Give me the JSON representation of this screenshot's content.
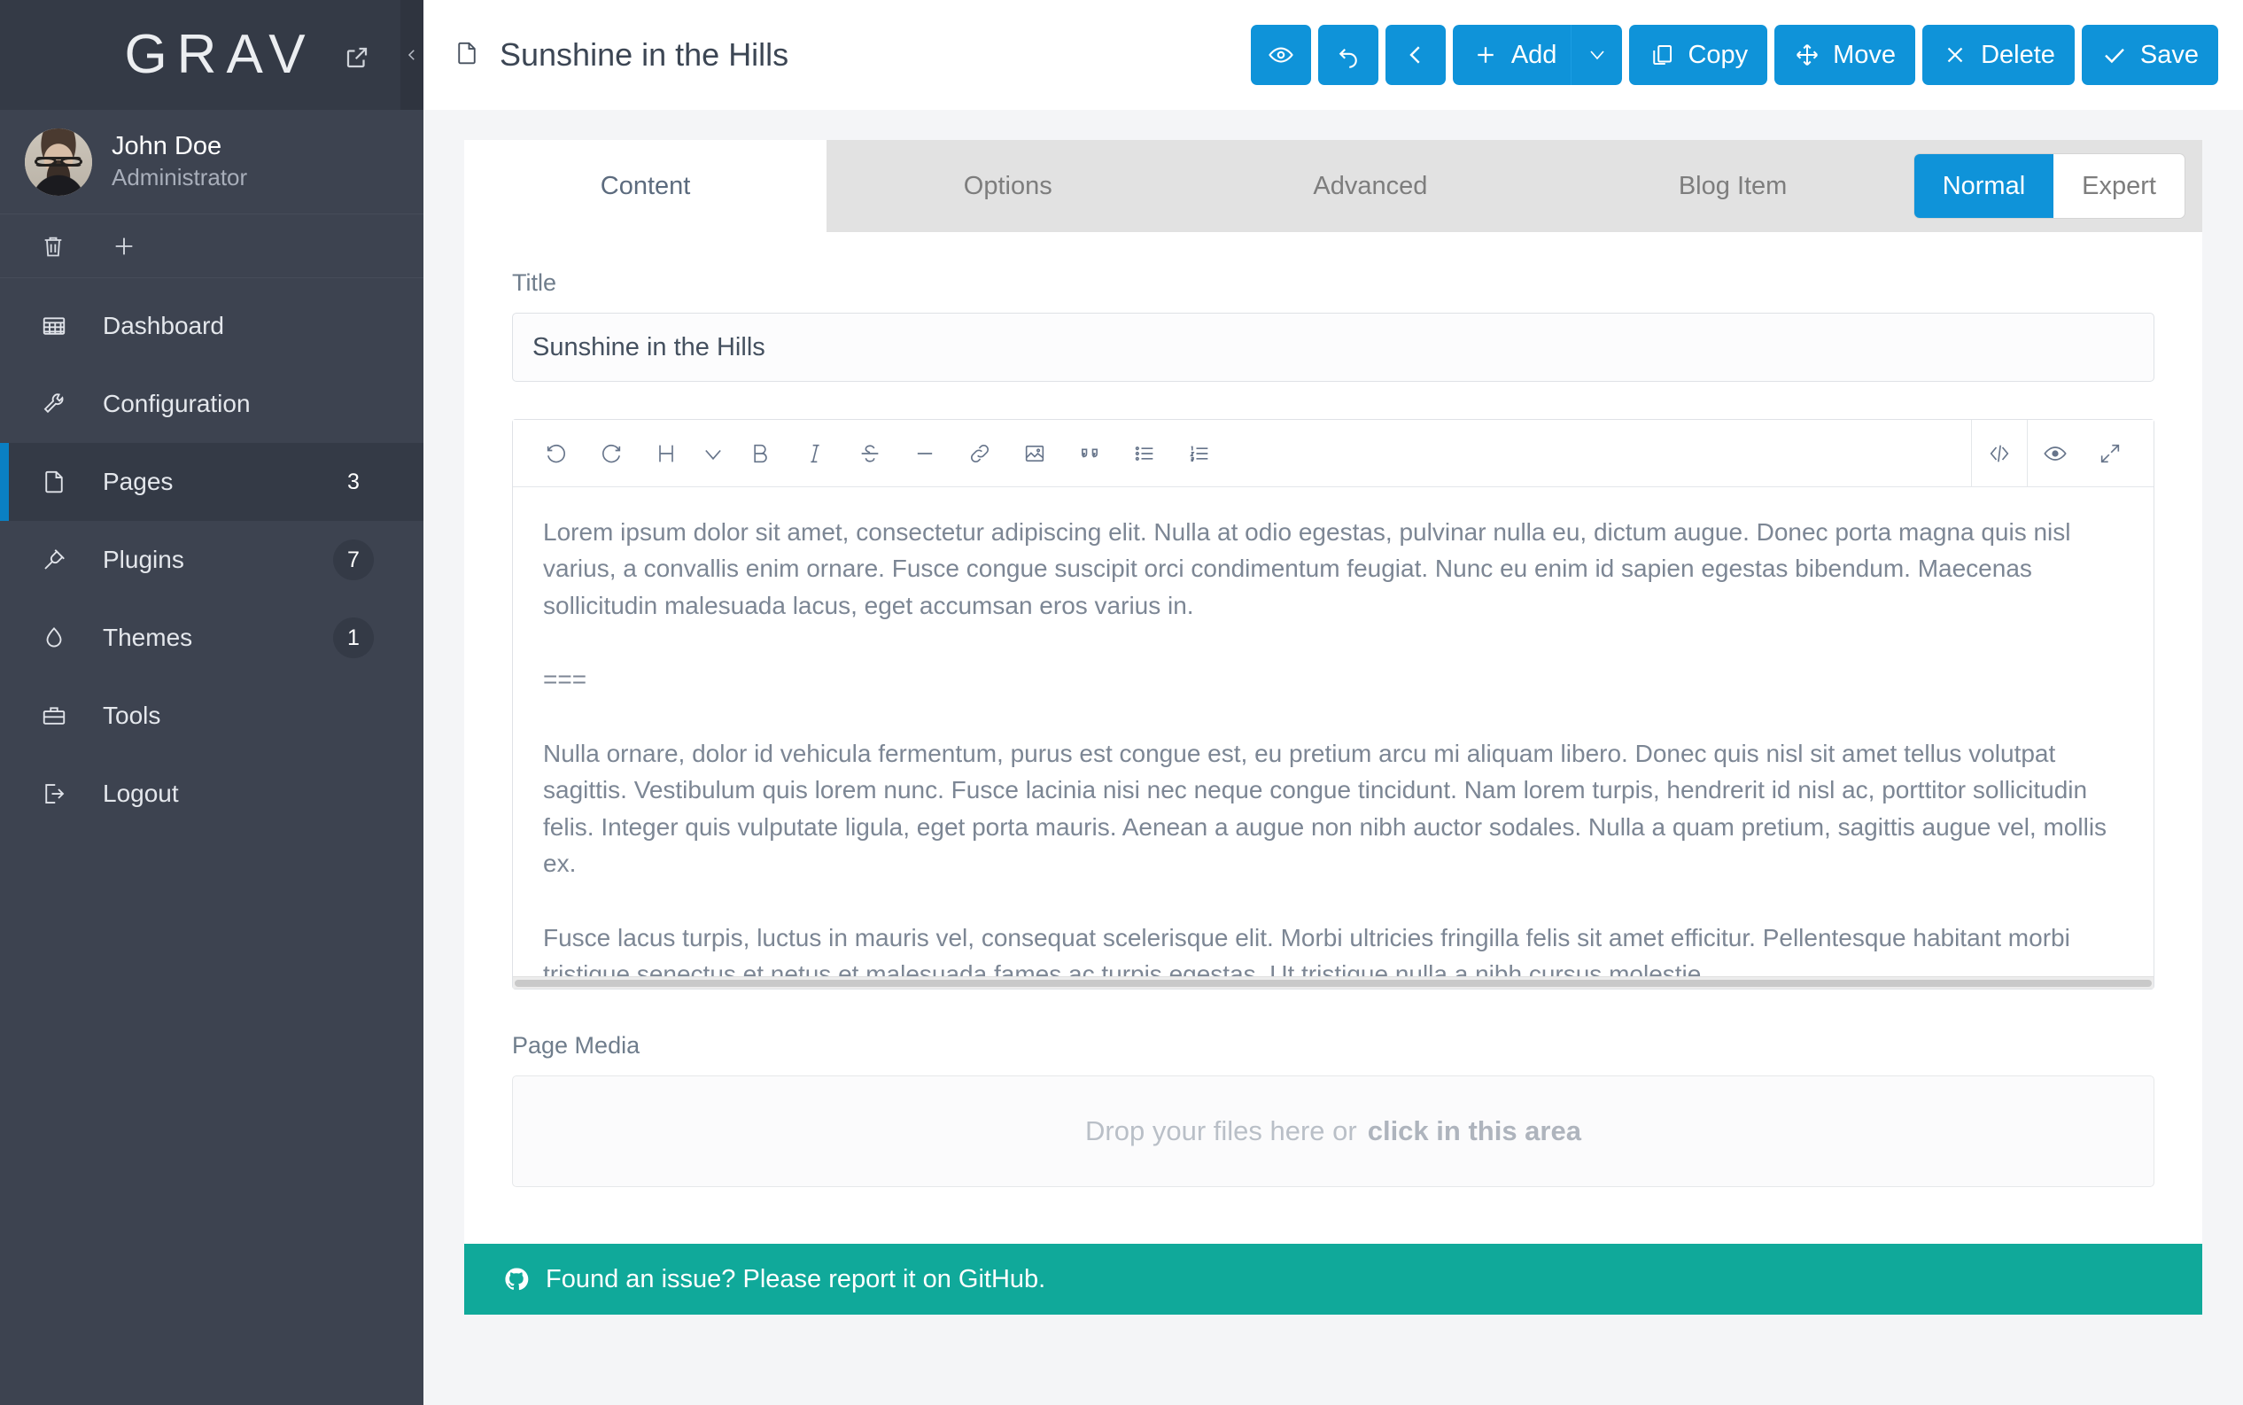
{
  "sidebar": {
    "logo_text": "GRAV",
    "logo_external_icon": "external-link-icon",
    "collapse_icon": "chevron-left-icon",
    "user": {
      "name": "John Doe",
      "role": "Administrator"
    },
    "quick_actions": [
      {
        "icon": "trash-icon",
        "name": "clear-cache"
      },
      {
        "icon": "plus-icon",
        "name": "add-page"
      }
    ],
    "items": [
      {
        "label": "Dashboard",
        "icon": "grid-icon",
        "badge": "",
        "active": false
      },
      {
        "label": "Configuration",
        "icon": "wrench-icon",
        "badge": "",
        "active": false
      },
      {
        "label": "Pages",
        "icon": "file-icon",
        "badge": "3",
        "active": true
      },
      {
        "label": "Plugins",
        "icon": "plug-icon",
        "badge": "7",
        "active": false
      },
      {
        "label": "Themes",
        "icon": "droplet-icon",
        "badge": "1",
        "active": false
      },
      {
        "label": "Tools",
        "icon": "toolbox-icon",
        "badge": "",
        "active": false
      },
      {
        "label": "Logout",
        "icon": "logout-icon",
        "badge": "",
        "active": false
      }
    ]
  },
  "topbar": {
    "page_icon": "file-icon",
    "page_title": "Sunshine in the Hills",
    "buttons": {
      "preview": "",
      "undo": "",
      "back": "",
      "add": "Add",
      "copy": "Copy",
      "move": "Move",
      "delete": "Delete",
      "save": "Save"
    }
  },
  "tabs": [
    {
      "label": "Content",
      "active": true
    },
    {
      "label": "Options",
      "active": false
    },
    {
      "label": "Advanced",
      "active": false
    },
    {
      "label": "Blog Item",
      "active": false
    }
  ],
  "mode_toggle": {
    "normal": "Normal",
    "expert": "Expert",
    "selected": "Normal"
  },
  "form": {
    "title_label": "Title",
    "title_value": "Sunshine in the Hills",
    "title_placeholder": "",
    "editor_paragraphs": [
      "Lorem ipsum dolor sit amet, consectetur adipiscing elit. Nulla at odio egestas, pulvinar nulla eu, dictum augue. Donec porta magna quis nisl varius, a convallis enim ornare. Fusce congue suscipit orci condimentum feugiat. Nunc eu enim id sapien egestas bibendum. Maecenas sollicitudin malesuada lacus, eget accumsan eros varius in.",
      "===",
      "Nulla ornare, dolor id vehicula fermentum, purus est congue est, eu pretium arcu mi aliquam libero. Donec quis nisl sit amet tellus volutpat sagittis. Vestibulum quis lorem nunc. Fusce lacinia nisi nec neque congue tincidunt. Nam lorem turpis, hendrerit id nisl ac, porttitor sollicitudin felis. Integer quis vulputate ligula, eget porta mauris. Aenean a augue non nibh auctor sodales. Nulla a quam pretium, sagittis augue vel, mollis ex.",
      "Fusce lacus turpis, luctus in mauris vel, consequat scelerisque elit. Morbi ultricies fringilla felis sit amet efficitur. Pellentesque habitant morbi tristique senectus et netus et malesuada fames ac turpis egestas. Ut tristique nulla a nibh cursus molestie."
    ],
    "media_label": "Page Media",
    "dropzone_text": "Drop your files here or",
    "dropzone_link": "click in this area"
  },
  "editor_toolbar": {
    "left_icons": [
      "undo-icon",
      "redo-icon",
      "heading-icon",
      "chevron-down-icon",
      "bold-icon",
      "italic-icon",
      "strikethrough-icon",
      "horizontal-rule-icon",
      "link-icon",
      "image-icon",
      "quote-icon",
      "unordered-list-icon",
      "ordered-list-icon"
    ],
    "right_icons": [
      "code-icon",
      "preview-eye-icon",
      "fullscreen-icon"
    ]
  },
  "footer": {
    "icon": "github-icon",
    "text": "Found an issue? Please report it on GitHub."
  },
  "colors": {
    "accent_blue": "#0f93d9",
    "sidebar_bg": "#3d4350",
    "sidebar_dark": "#343a46",
    "footer_teal": "#10a99a",
    "active_bar": "#0a80c3"
  }
}
